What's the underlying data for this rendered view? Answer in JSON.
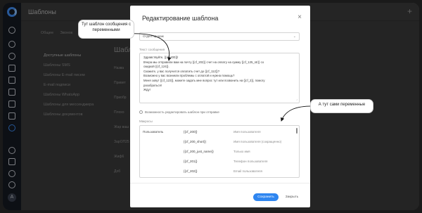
{
  "background": {
    "title": "Шаблоны",
    "plus": "+",
    "tabs": [
      "Общее",
      "Звонок"
    ],
    "menu": [
      "Доступные шаблоны",
      "Шаблоны SMS",
      "Шаблоны E-mail писем",
      "E-mail подписи",
      "Шаблоны WhatsApp",
      "Шаблоны для мессенджера",
      "Шаблоны документов"
    ],
    "heading": "Шабло",
    "rows": [
      "Назва",
      "Привет",
      "Приобр",
      "Плохо",
      "Жар ваш",
      "ЗарОП25",
      "Жиф6",
      "Доб"
    ]
  },
  "modal": {
    "title": "Редактирование шаблона",
    "close": "×",
    "department": "Отдел продаж",
    "message_label": "Текст сообщения",
    "message_lines": [
      "Здравствуйте, {{cf_200}}!",
      "Вчера мы отправили вам на почту {{cf_202}} счет на оплату на сумму {{cf_125_str}} со",
      "скидкой {{cf_124}}.",
      "Скажите, у вас получится оплатить счет до {{cf_112}}?",
      "Возможно у вас возникли проблемы с оплатой и нужна помощь?",
      "Меня зовут {{cf_123}}, можете задать мне вопрос тут или позвонить на {{cf_2}}, помогу",
      "разобраться!",
      "Жду!"
    ],
    "checkbox_label": "Возможность редактировать шаблон при отправке",
    "macros_label": "Макросы",
    "macros_category": "Пользователь",
    "macros": [
      {
        "code": "{{cf_200}}",
        "desc": "Имя пользователя"
      },
      {
        "code": "{{cf_200_short}}",
        "desc": "Имя пользователя (сокращенно)"
      },
      {
        "code": "{{cf_200_just_name}}",
        "desc": "Только имя"
      },
      {
        "code": "{{cf_201}}",
        "desc": "Телефон пользователя"
      },
      {
        "code": "{{cf_202}}",
        "desc": "Email пользователя"
      }
    ],
    "save": "Сохранить",
    "cancel": "Закрыть"
  },
  "callouts": {
    "template": "Тут шаблон сообщения с переменными",
    "variables": "А тут сами переменные"
  },
  "colors": {
    "accent": "#2f86f0",
    "sidebar": "#161a22",
    "backdrop": "#3a3a3a"
  },
  "icons": [
    "logo-icon",
    "dashboard-icon",
    "compass-icon",
    "globe-icon",
    "chat-icon",
    "book-icon",
    "documents-icon",
    "calendar-icon",
    "mail-icon",
    "settings-icon",
    "help-icon",
    "tasks-icon",
    "users-icon",
    "bell-icon"
  ]
}
